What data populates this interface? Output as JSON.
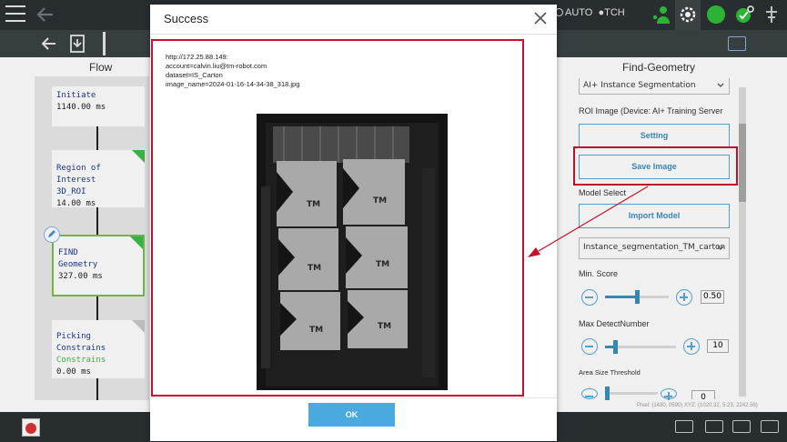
{
  "topbar": {
    "mode_auto": "AUTO",
    "mode_tch": "TCH"
  },
  "flow": {
    "title": "Flow",
    "nodes": [
      {
        "line1": "Initiate",
        "line2": "",
        "time": "1140.00 ms"
      },
      {
        "line1": "Region of Interest",
        "line2": "3D_ROI",
        "time": "14.00 ms"
      },
      {
        "line1": "FIND",
        "line2": "Geometry",
        "time": "327.00 ms"
      },
      {
        "line1": "Picking Constrains",
        "line2": "Constrains",
        "time": "0.00 ms"
      }
    ]
  },
  "panel": {
    "title": "Find-Geometry",
    "method_select": "AI+ Instance Segmentation",
    "roi_label": "ROI Image (Device: AI+ Training Server",
    "setting_button": "Setting",
    "save_image_button": "Save Image",
    "model_select_label": "Model Select",
    "import_model_button": "Import Model",
    "model_value": "Instance_segmentation_TM_carton",
    "min_score_label": "Min. Score",
    "min_score_value": "0.50",
    "min_score_fraction": 0.5,
    "max_detect_label": "Max DetectNumber",
    "max_detect_value": "10",
    "area_size_label": "Area Size Threshold",
    "area_size_value": "0",
    "status_line": "Pixel: (1430, 0590)  XYZ: (1020.32, 5.23, 2242.59)"
  },
  "dialog": {
    "title": "Success",
    "message_lines": [
      "http://172.25.88.149:",
      "account=calvin.liu@tm-robot.com",
      "dataset=IS_Carton",
      "image_name=2024-01-16-14-34-38_318.jpg"
    ],
    "ok_button": "OK"
  },
  "colors": {
    "accent": "#4aaae0",
    "highlight": "#c8102e",
    "node_green": "#3dbb47"
  }
}
